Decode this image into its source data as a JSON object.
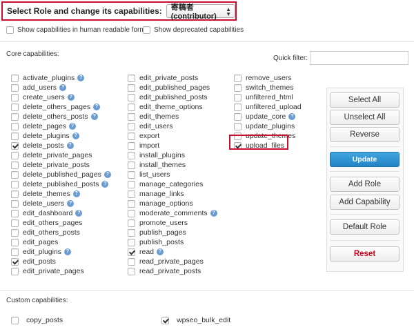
{
  "role_bar": {
    "label": "Select Role and change its capabilities:",
    "selected_role": "寄稿者 (contributor)"
  },
  "options": {
    "human_readable_label": "Show capabilities in human readable form",
    "deprecated_label": "Show deprecated capabilities"
  },
  "core": {
    "title": "Core capabilities:",
    "quick_filter_label": "Quick filter:",
    "quick_filter_value": "",
    "columns": [
      [
        {
          "label": "activate_plugins",
          "checked": false,
          "help": true
        },
        {
          "label": "add_users",
          "checked": false,
          "help": true
        },
        {
          "label": "create_users",
          "checked": false,
          "help": true
        },
        {
          "label": "delete_others_pages",
          "checked": false,
          "help": true
        },
        {
          "label": "delete_others_posts",
          "checked": false,
          "help": true
        },
        {
          "label": "delete_pages",
          "checked": false,
          "help": true
        },
        {
          "label": "delete_plugins",
          "checked": false,
          "help": true
        },
        {
          "label": "delete_posts",
          "checked": true,
          "help": true
        },
        {
          "label": "delete_private_pages",
          "checked": false,
          "help": false
        },
        {
          "label": "delete_private_posts",
          "checked": false,
          "help": false
        },
        {
          "label": "delete_published_pages",
          "checked": false,
          "help": true
        },
        {
          "label": "delete_published_posts",
          "checked": false,
          "help": true
        },
        {
          "label": "delete_themes",
          "checked": false,
          "help": true
        },
        {
          "label": "delete_users",
          "checked": false,
          "help": true
        },
        {
          "label": "edit_dashboard",
          "checked": false,
          "help": true
        },
        {
          "label": "edit_others_pages",
          "checked": false,
          "help": false
        },
        {
          "label": "edit_others_posts",
          "checked": false,
          "help": false
        },
        {
          "label": "edit_pages",
          "checked": false,
          "help": false
        },
        {
          "label": "edit_plugins",
          "checked": false,
          "help": true
        },
        {
          "label": "edit_posts",
          "checked": true,
          "help": false
        },
        {
          "label": "edit_private_pages",
          "checked": false,
          "help": false
        }
      ],
      [
        {
          "label": "edit_private_posts",
          "checked": false,
          "help": false
        },
        {
          "label": "edit_published_pages",
          "checked": false,
          "help": false
        },
        {
          "label": "edit_published_posts",
          "checked": false,
          "help": false
        },
        {
          "label": "edit_theme_options",
          "checked": false,
          "help": false
        },
        {
          "label": "edit_themes",
          "checked": false,
          "help": false
        },
        {
          "label": "edit_users",
          "checked": false,
          "help": false
        },
        {
          "label": "export",
          "checked": false,
          "help": false
        },
        {
          "label": "import",
          "checked": false,
          "help": false
        },
        {
          "label": "install_plugins",
          "checked": false,
          "help": false
        },
        {
          "label": "install_themes",
          "checked": false,
          "help": false
        },
        {
          "label": "list_users",
          "checked": false,
          "help": false
        },
        {
          "label": "manage_categories",
          "checked": false,
          "help": false
        },
        {
          "label": "manage_links",
          "checked": false,
          "help": false
        },
        {
          "label": "manage_options",
          "checked": false,
          "help": false
        },
        {
          "label": "moderate_comments",
          "checked": false,
          "help": true
        },
        {
          "label": "promote_users",
          "checked": false,
          "help": false
        },
        {
          "label": "publish_pages",
          "checked": false,
          "help": false
        },
        {
          "label": "publish_posts",
          "checked": false,
          "help": false
        },
        {
          "label": "read",
          "checked": true,
          "help": true
        },
        {
          "label": "read_private_pages",
          "checked": false,
          "help": false
        },
        {
          "label": "read_private_posts",
          "checked": false,
          "help": false
        }
      ],
      [
        {
          "label": "remove_users",
          "checked": false,
          "help": false
        },
        {
          "label": "switch_themes",
          "checked": false,
          "help": false
        },
        {
          "label": "unfiltered_html",
          "checked": false,
          "help": false
        },
        {
          "label": "unfiltered_upload",
          "checked": false,
          "help": false
        },
        {
          "label": "update_core",
          "checked": false,
          "help": true
        },
        {
          "label": "update_plugins",
          "checked": false,
          "help": false
        },
        {
          "label": "update_themes",
          "checked": false,
          "help": false
        },
        {
          "label": "upload_files",
          "checked": true,
          "help": false
        }
      ]
    ]
  },
  "buttons": {
    "select_all": "Select All",
    "unselect_all": "Unselect All",
    "reverse": "Reverse",
    "update": "Update",
    "add_role": "Add Role",
    "add_capability": "Add Capability",
    "default_role": "Default Role",
    "reset": "Reset"
  },
  "custom": {
    "title": "Custom capabilities:",
    "items": [
      {
        "label": "copy_posts",
        "checked": false
      },
      {
        "label": "wpseo_bulk_edit",
        "checked": true
      }
    ]
  },
  "colors": {
    "highlight": "#c8102e",
    "primary": "#2484c6",
    "danger": "#d0021b",
    "help_icon": "#6a9bd1"
  }
}
